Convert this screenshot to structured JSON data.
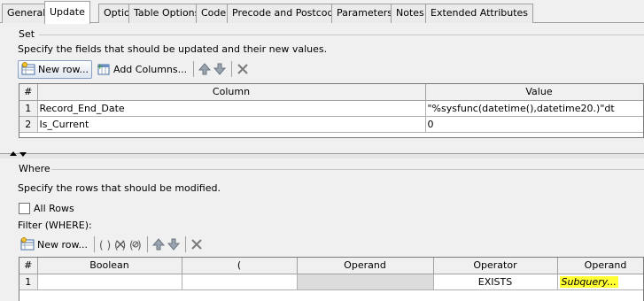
{
  "tabs": [
    {
      "label": "General"
    },
    {
      "label": "Update"
    },
    {
      "label": "Options"
    },
    {
      "label": "Table Options"
    },
    {
      "label": "Code"
    },
    {
      "label": "Precode and Postcode"
    },
    {
      "label": "Parameters"
    },
    {
      "label": "Notes"
    },
    {
      "label": "Extended Attributes"
    }
  ],
  "set_section": {
    "title": "Set",
    "description": "Specify the fields that should be updated and their new values.",
    "toolbar": {
      "new_row_label": "New row...",
      "add_columns_label": "Add Columns..."
    },
    "grid": {
      "headers": {
        "index": "#",
        "column": "Column",
        "value": "Value"
      },
      "rows": [
        {
          "num": "1",
          "column": "Record_End_Date",
          "value": "\"%sysfunc(datetime(),datetime20.)\"dt"
        },
        {
          "num": "2",
          "column": "Is_Current",
          "value": "0"
        }
      ]
    }
  },
  "where_section": {
    "title": "Where",
    "description": "Specify the rows that should be modified.",
    "all_rows_label": "All Rows",
    "filter_label": "Filter (WHERE):",
    "toolbar": {
      "new_row_label": "New row..."
    },
    "grid": {
      "headers": {
        "index": "#",
        "boolean": "Boolean",
        "paren": "(",
        "operand1": "Operand",
        "operator": "Operator",
        "operand2": "Operand"
      },
      "rows": [
        {
          "num": "1",
          "boolean": "",
          "paren": "",
          "operand1": "",
          "operator": "EXISTS",
          "operand2": "Subquery..."
        }
      ]
    }
  },
  "colors": {
    "highlight": "#ffff33",
    "selected_tab": "#ffffff",
    "background": "#f0f0f0"
  }
}
